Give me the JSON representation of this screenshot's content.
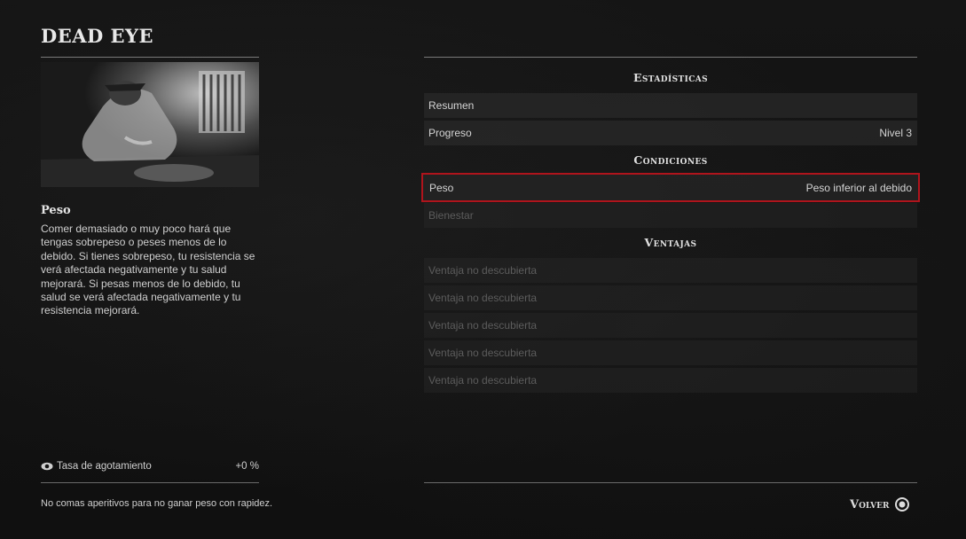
{
  "title": "DEAD EYE",
  "info": {
    "title": "Peso",
    "description": "Comer demasiado o muy poco hará que tengas sobrepeso o peses menos de lo debido. Si tienes sobrepeso, tu resistencia se verá afectada negativamente y tu salud mejorará. Si pesas menos de lo debido, tu salud se verá afectada negativamente y tu resistencia mejorará."
  },
  "stat": {
    "icon": "eye-icon",
    "label": "Tasa de agotamiento",
    "value": "+0 %"
  },
  "hint": "No comas aperitivos para no ganar peso con rapidez.",
  "sections": {
    "stats": {
      "header": "Estadísticas",
      "rows": [
        {
          "label": "Resumen",
          "value": ""
        },
        {
          "label": "Progreso",
          "value": "Nivel 3"
        }
      ]
    },
    "conditions": {
      "header": "Condiciones",
      "rows": [
        {
          "label": "Peso",
          "value": "Peso inferior al debido"
        },
        {
          "label": "Bienestar",
          "value": ""
        }
      ]
    },
    "perks": {
      "header": "Ventajas",
      "rows": [
        {
          "label": "Ventaja no descubierta"
        },
        {
          "label": "Ventaja no descubierta"
        },
        {
          "label": "Ventaja no descubierta"
        },
        {
          "label": "Ventaja no descubierta"
        },
        {
          "label": "Ventaja no descubierta"
        }
      ]
    }
  },
  "back_button": {
    "label": "Volver",
    "icon": "circle-button-icon"
  },
  "colors": {
    "selection_border": "#b0141c",
    "background": "#121212"
  }
}
